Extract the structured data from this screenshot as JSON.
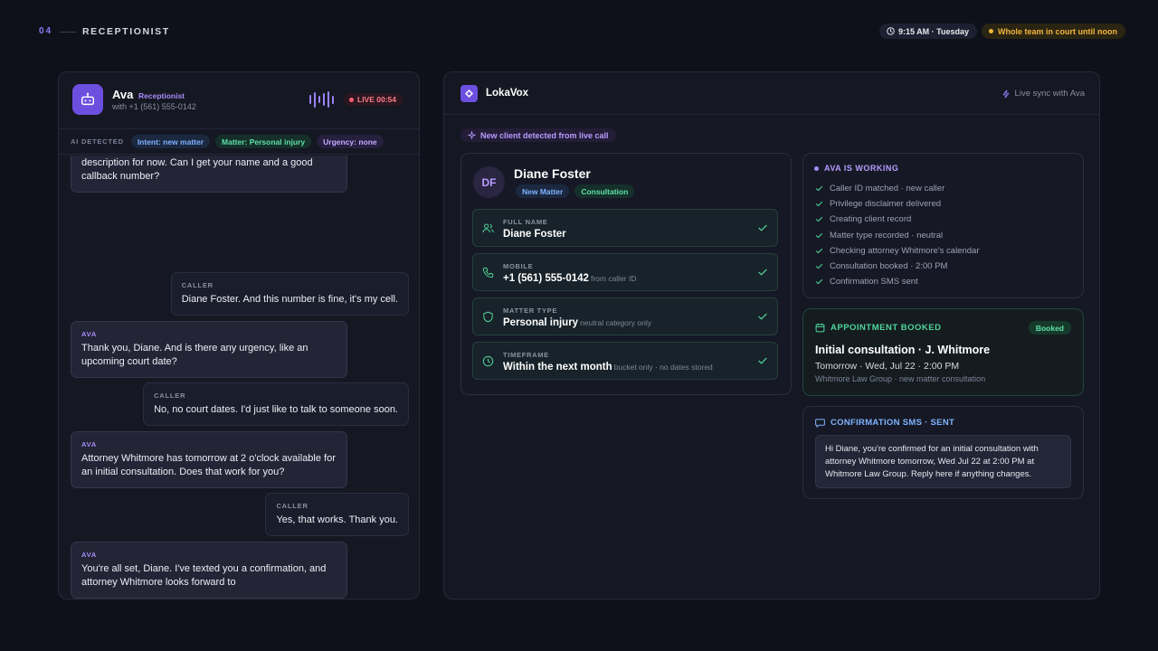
{
  "header": {
    "slide_number": "04",
    "slide_title": "RECEPTIONIST",
    "time_label": "9:15 AM · Tuesday",
    "alert_label": "Whole team in court until noon"
  },
  "call": {
    "agent_name": "Ava",
    "agent_role": "Receptionist",
    "caller_line": "with +1 (561) 555-0142",
    "live_label": "LIVE 00:54",
    "detected_label": "AI DETECTED",
    "tags": {
      "intent": "Intent: new matter",
      "matter": "Matter: Personal injury",
      "urgency": "Urgency: none"
    },
    "messages": [
      {
        "speaker": "",
        "text": "description for now. Can I get your name and a good callback number?"
      },
      {
        "speaker": "CALLER",
        "text": "Diane Foster. And this number is fine, it's my cell."
      },
      {
        "speaker": "AVA",
        "text": "Thank you, Diane. And is there any urgency, like an upcoming court date?"
      },
      {
        "speaker": "CALLER",
        "text": "No, no court dates. I'd just like to talk to someone soon."
      },
      {
        "speaker": "AVA",
        "text": "Attorney Whitmore has tomorrow at 2 o'clock available for an initial consultation. Does that work for you?"
      },
      {
        "speaker": "CALLER",
        "text": "Yes, that works. Thank you."
      },
      {
        "speaker": "AVA",
        "text": "You're all set, Diane. I've texted you a confirmation, and attorney Whitmore looks forward to"
      }
    ]
  },
  "crm": {
    "app_name": "LokaVox",
    "sync_label": "Live sync with Ava",
    "new_client_label": "New client detected from live call",
    "client": {
      "initials": "DF",
      "name": "Diane Foster",
      "tag_new": "New Matter",
      "tag_type": "Consultation"
    },
    "fields": {
      "full_name": {
        "label": "FULL NAME",
        "value": "Diane Foster",
        "note": ""
      },
      "mobile": {
        "label": "MOBILE",
        "value": "+1 (561) 555-0142",
        "note": "from caller ID"
      },
      "matter_type": {
        "label": "MATTER TYPE",
        "value": "Personal injury",
        "note": "neutral category only"
      },
      "timeframe": {
        "label": "TIMEFRAME",
        "value": "Within the next month",
        "note": "bucket only · no dates stored"
      }
    },
    "working": {
      "title": "AVA IS WORKING",
      "steps": [
        "Caller ID matched · new caller",
        "Privilege disclaimer delivered",
        "Creating client record",
        "Matter type recorded · neutral",
        "Checking attorney Whitmore's calendar",
        "Consultation booked · 2:00 PM",
        "Confirmation SMS sent"
      ]
    },
    "appointment": {
      "title": "APPOINTMENT BOOKED",
      "badge": "Booked",
      "main": "Initial consultation · J. Whitmore",
      "when": "Tomorrow · Wed, Jul 22 · 2:00 PM",
      "where": "Whitmore Law Group · new matter consultation"
    },
    "sms": {
      "title": "CONFIRMATION SMS · SENT",
      "body": "Hi Diane, you're confirmed for an initial consultation with attorney Whitmore tomorrow, Wed Jul 22 at 2:00 PM at Whitmore Law Group. Reply here if anything changes."
    }
  },
  "colors": {
    "accent": "#8b7cf6",
    "success": "#4fd69a",
    "info": "#7fb3ff",
    "warning": "#f2b53a",
    "live": "#ff5d6f"
  },
  "icons": [
    "clock-icon",
    "robot-icon",
    "waveform-icon",
    "sparkle-icon",
    "lightning-icon",
    "users-icon",
    "phone-icon",
    "shield-icon",
    "clock-icon",
    "check-icon",
    "calendar-icon",
    "chat-icon"
  ]
}
